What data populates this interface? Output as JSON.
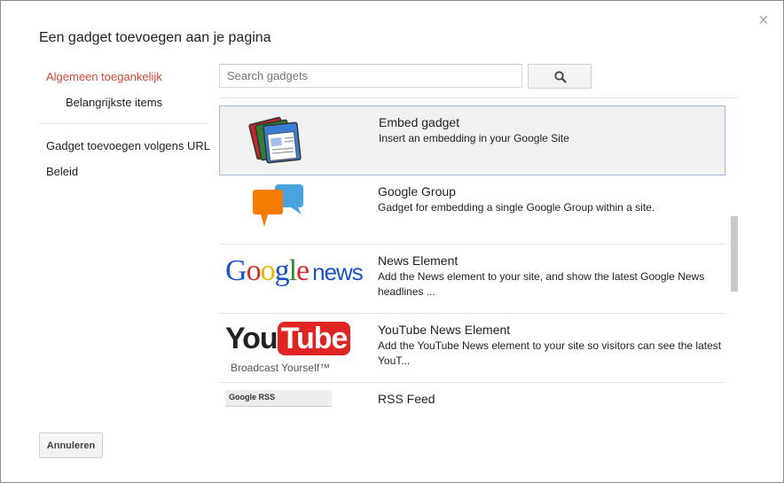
{
  "dialog": {
    "title": "Een gadget toevoegen aan je pagina",
    "close_icon": "×"
  },
  "nav": {
    "items": [
      {
        "label": "Algemeen toegankelijk",
        "active": true
      },
      {
        "label": "Belangrijkste items"
      },
      {
        "label": "Gadget toevoegen volgens URL"
      },
      {
        "label": "Beleid"
      }
    ]
  },
  "search": {
    "placeholder": "Search gadgets",
    "value": "",
    "button_icon": "search-icon"
  },
  "gadgets": [
    {
      "name": "Embed gadget",
      "description": "Insert an embedding in your Google Site",
      "thumb": "stacked-browser-windows-icon",
      "selected": true
    },
    {
      "name": "Google Group",
      "description": "Gadget for embedding a single Google Group within a site.",
      "thumb": "chat-bubbles-icon"
    },
    {
      "name": "News Element",
      "description": "Add the News element to your site, and show the latest Google News headlines ...",
      "thumb": "google-news-logo",
      "thumb_text": "Google news"
    },
    {
      "name": "YouTube News Element",
      "description": "Add the YouTube News element to your site so visitors can see the latest YouT...",
      "thumb": "youtube-logo",
      "thumb_text": "YouTube",
      "thumb_tagline": "Broadcast Yourself™"
    },
    {
      "name": "RSS Feed",
      "description": "",
      "thumb": "google-rss-thumb",
      "thumb_text": "Google RSS"
    }
  ],
  "footer": {
    "cancel_label": "Annuleren"
  },
  "colors": {
    "accent_red": "#d14836",
    "selected_row_bg": "#f1f1f1",
    "selected_row_border": "#a0b8db"
  }
}
